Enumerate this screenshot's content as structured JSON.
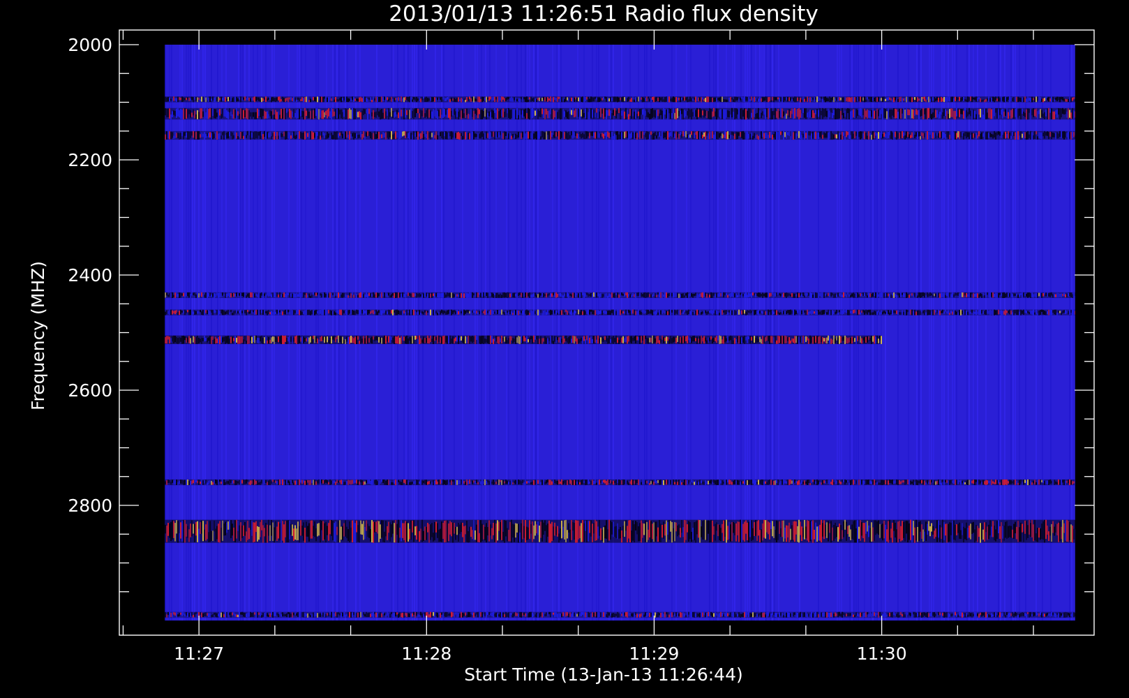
{
  "chart_data": {
    "type": "heatmap",
    "title": "2013/01/13 11:26:51 Radio flux density",
    "xlabel": "Start Time (13-Jan-13 11:26:44)",
    "ylabel": "Frequency (MHZ)",
    "x_start": "11:26:51",
    "x_end": "11:30:51",
    "xlim": [
      "11:26:39",
      "11:30:56"
    ],
    "x_ticks": [
      "11:27",
      "11:28",
      "11:29",
      "11:30"
    ],
    "ylim": [
      2000,
      3000
    ],
    "y_axis_inverted": true,
    "y_ticks": [
      2000,
      2200,
      2400,
      2600,
      2800
    ],
    "y_minor_step": 50,
    "colormap": [
      "#000000",
      "#2020ff",
      "#ff2020",
      "#ffe040"
    ],
    "background_color": "#2a1fd6",
    "frame_color": "#ffffff",
    "features": [
      {
        "freq_range": [
          2090,
          2100
        ],
        "time_range": [
          "11:26:51",
          "11:30:51"
        ],
        "intensity": 0.65
      },
      {
        "freq_range": [
          2110,
          2130
        ],
        "time_range": [
          "11:26:51",
          "11:30:51"
        ],
        "intensity": 0.6
      },
      {
        "freq_range": [
          2150,
          2165
        ],
        "time_range": [
          "11:26:51",
          "11:30:51"
        ],
        "intensity": 0.55
      },
      {
        "freq_range": [
          2430,
          2440
        ],
        "time_range": [
          "11:26:51",
          "11:30:51"
        ],
        "intensity": 0.35
      },
      {
        "freq_range": [
          2460,
          2470
        ],
        "time_range": [
          "11:26:51",
          "11:30:51"
        ],
        "intensity": 0.35
      },
      {
        "freq_range": [
          2505,
          2520
        ],
        "time_range": [
          "11:26:51",
          "11:30:00"
        ],
        "intensity": 0.9
      },
      {
        "freq_range": [
          2755,
          2765
        ],
        "time_range": [
          "11:26:51",
          "11:30:51"
        ],
        "intensity": 0.6
      },
      {
        "freq_range": [
          2825,
          2865
        ],
        "time_range": [
          "11:26:51",
          "11:30:51"
        ],
        "intensity": 1.0
      },
      {
        "freq_range": [
          2985,
          2995
        ],
        "time_range": [
          "11:26:51",
          "11:30:51"
        ],
        "intensity": 0.4
      }
    ]
  }
}
